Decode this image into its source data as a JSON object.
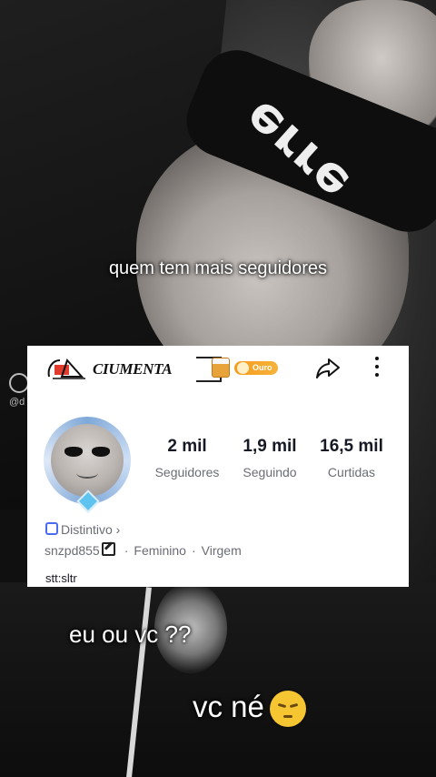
{
  "captions": {
    "top": "quem tem mais seguidores",
    "middle": "eu ou vc ??",
    "bottom": "vc né"
  },
  "side_ui": {
    "handle": "@d"
  },
  "profile": {
    "name": "CIUMENTA",
    "badge": "Ouro",
    "stats": [
      {
        "value": "2 mil",
        "label": "Seguidores"
      },
      {
        "value": "1,9 mil",
        "label": "Seguindo"
      },
      {
        "value": "16,5 mil",
        "label": "Curtidas"
      }
    ],
    "distintivo": "Distintivo",
    "username": "snzpd855",
    "gender": "Feminino",
    "sign": "Virgem",
    "bio": "stt:sltr"
  },
  "icons": {
    "share": "share-arrow-icon",
    "more": "vertical-dots-icon",
    "emoji": "pensive-face-emoji"
  },
  "colors": {
    "badge_gold": "#f59b1e",
    "distintivo_blue": "#4a6cf0",
    "card_bg": "#ffffff"
  }
}
